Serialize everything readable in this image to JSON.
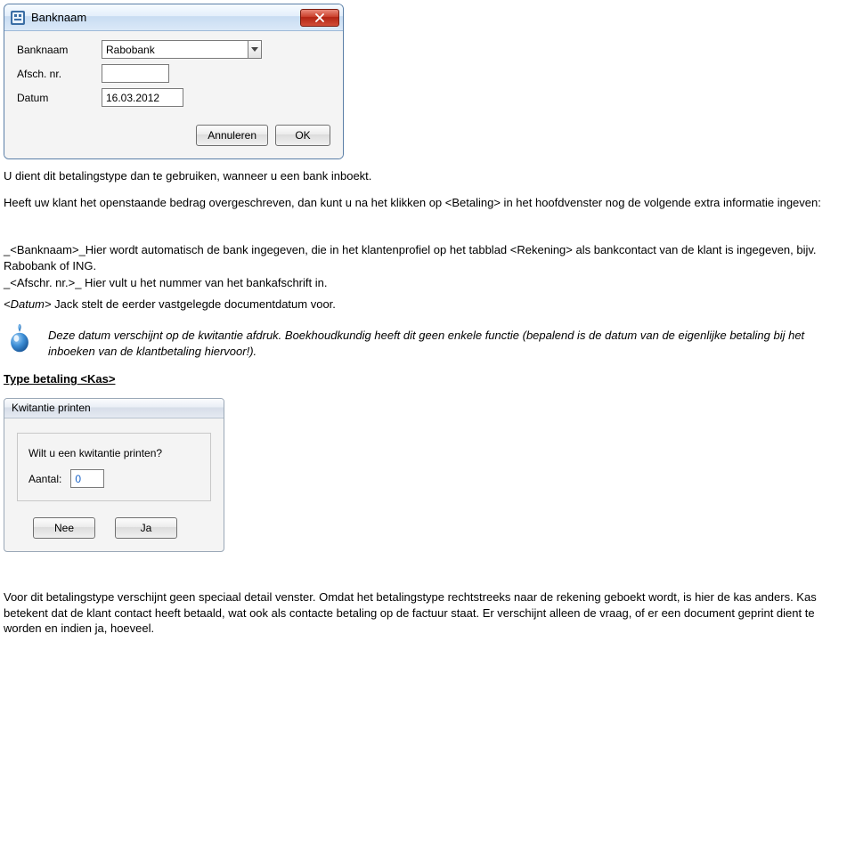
{
  "dialog1": {
    "title": "Banknaam",
    "labels": {
      "banknaam": "Banknaam",
      "afsch": "Afsch. nr.",
      "datum": "Datum"
    },
    "values": {
      "banknaam": "Rabobank",
      "afsch": "",
      "datum": "16.03.2012"
    },
    "buttons": {
      "cancel": "Annuleren",
      "ok": "OK"
    }
  },
  "para1": "U dient dit betalingstype dan te gebruiken, wanneer u een bank inboekt.",
  "para2": "Heeft uw klant het openstaande bedrag overgeschreven, dan kunt u na het klikken op <Betaling> in het hoofdvenster nog de volgende extra informatie ingeven:",
  "para3": "_<Banknaam>_Hier wordt automatisch de bank ingegeven, die in het klantenprofiel op het tabblad <Rekening> als bankcontact van de klant is ingegeven, bijv. Rabobank of ING.",
  "para4": "_<Afschr. nr.>_ Hier vult u het nummer van het bankafschrift in.",
  "para5_prefix": "<Datum>",
  "para5_rest": " Jack stelt de eerder vastgelegde documentdatum voor.",
  "note_italic": "Deze datum verschijnt op de kwitantie afdruk. Boekhoudkundig heeft dit geen enkele functie (bepalend is de datum van de eigenlijke betaling bij het inboeken van de klantbetaling hiervoor!).",
  "section_heading": "Type betaling <Kas>",
  "dialog2": {
    "title": "Kwitantie printen",
    "prompt": "Wilt u een kwitantie printen?",
    "aantal_label": "Aantal:",
    "aantal_value": "0",
    "buttons": {
      "no": "Nee",
      "yes": "Ja"
    }
  },
  "para6": "Voor dit betalingstype verschijnt geen speciaal detail venster. Omdat het betalingstype rechtstreeks naar de rekening geboekt wordt, is hier de kas anders. Kas betekent dat de klant contact heeft betaald, wat ook als contacte betaling op de factuur staat. Er verschijnt alleen de vraag, of er een document geprint dient te worden en indien ja, hoeveel."
}
